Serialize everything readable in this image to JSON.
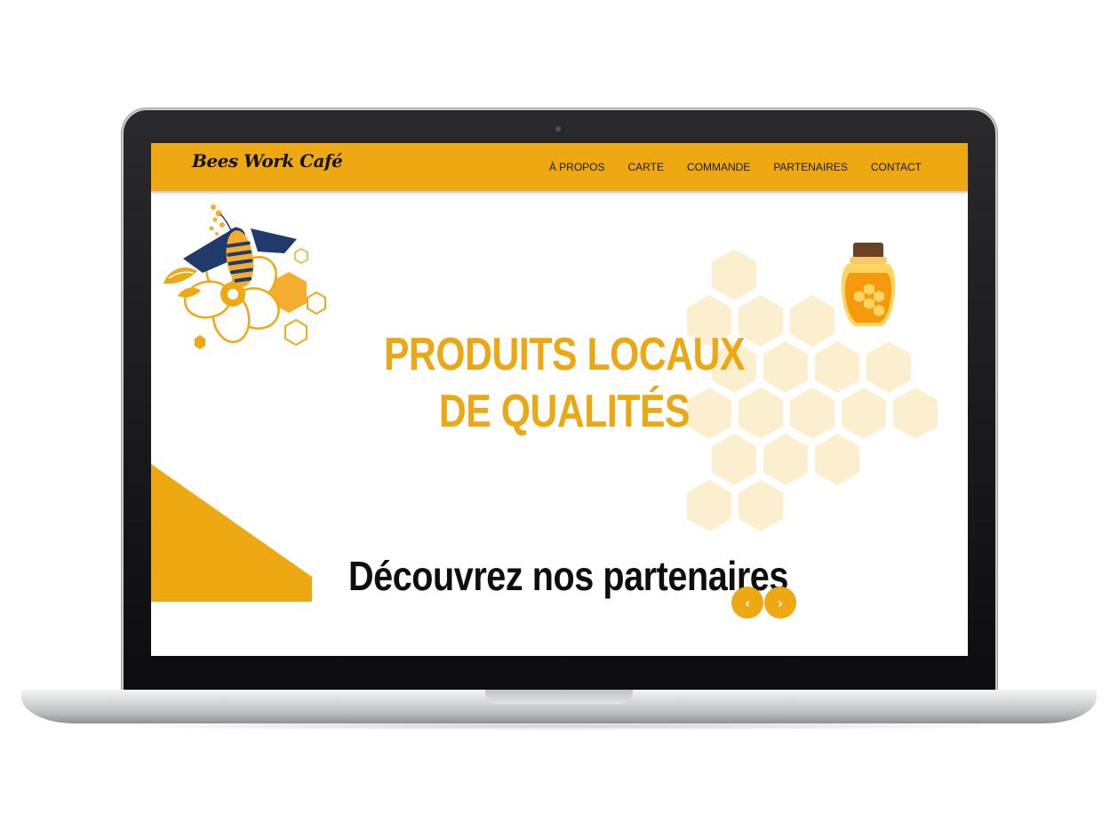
{
  "brand": {
    "name": "Bees Work Café"
  },
  "nav": {
    "items": [
      {
        "label": "À PROPOS"
      },
      {
        "label": "CARTE"
      },
      {
        "label": "COMMANDE"
      },
      {
        "label": "PARTENAIRES"
      },
      {
        "label": "CONTACT"
      }
    ]
  },
  "hero": {
    "title": "PRODUITS LOCAUX DE QUALITÉS"
  },
  "partners": {
    "heading": "Découvrez nos partenaires",
    "prev_icon": "chevron-left-icon",
    "next_icon": "chevron-right-icon"
  },
  "colors": {
    "accent": "#eda812",
    "honey_light": "#fcefd0",
    "navy": "#1f3a6b",
    "text_dark": "#0e0e0e"
  }
}
